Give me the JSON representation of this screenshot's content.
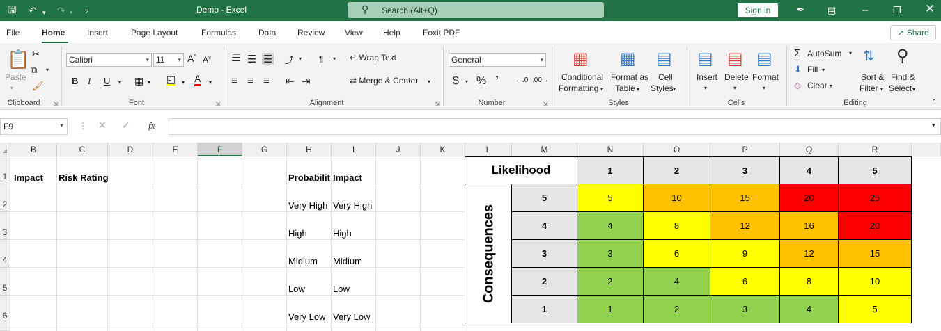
{
  "title": "Demo  -  Excel",
  "search_placeholder": "Search (Alt+Q)",
  "signin": "Sign in",
  "tabs": [
    "File",
    "Home",
    "Insert",
    "Page Layout",
    "Formulas",
    "Data",
    "Review",
    "View",
    "Help",
    "Foxit PDF"
  ],
  "share": "Share",
  "ribbon": {
    "paste": "Paste",
    "font_name": "Calibri",
    "font_size": "11",
    "wrap_text": "Wrap Text",
    "merge_center": "Merge & Center",
    "number_format": "General",
    "cond_fmt": [
      "Conditional",
      "Formatting"
    ],
    "format_table": [
      "Format as",
      "Table"
    ],
    "cell_styles": [
      "Cell",
      "Styles"
    ],
    "insert": "Insert",
    "delete": "Delete",
    "format": "Format",
    "autosum": "AutoSum",
    "fill": "Fill",
    "clear": "Clear",
    "sort_filter": [
      "Sort &",
      "Filter"
    ],
    "find_select": [
      "Find &",
      "Select"
    ],
    "groups": {
      "clipboard": "Clipboard",
      "font": "Font",
      "alignment": "Alignment",
      "number": "Number",
      "styles": "Styles",
      "cells": "Cells",
      "editing": "Editing"
    }
  },
  "name_box": "F9",
  "formula_fx": "fx",
  "columns": [
    "B",
    "C",
    "D",
    "E",
    "F",
    "G",
    "H",
    "I",
    "J",
    "K",
    "L",
    "M",
    "N",
    "O",
    "P",
    "Q",
    "R"
  ],
  "rows": [
    "1",
    "2",
    "3",
    "4",
    "5",
    "6"
  ],
  "cells": {
    "B1": "Impact",
    "C1": "Risk Rating",
    "H1": "Probabilit",
    "I1": "Impact",
    "H2": "Very High",
    "I2": "Very High",
    "H3": "High",
    "I3": "High",
    "H4": "Midium",
    "I4": "Midium",
    "H5": "Low",
    "I5": "Low",
    "H6": "Very Low",
    "I6": "Very Low"
  },
  "matrix": {
    "likelihood_label": "Likelihood",
    "consequences_label": "Consequences",
    "likelihood": [
      "1",
      "2",
      "3",
      "4",
      "5"
    ],
    "consequences": [
      "5",
      "4",
      "3",
      "2",
      "1"
    ],
    "values": [
      [
        "5",
        "10",
        "15",
        "20",
        "25"
      ],
      [
        "4",
        "8",
        "12",
        "16",
        "20"
      ],
      [
        "3",
        "6",
        "9",
        "12",
        "15"
      ],
      [
        "2",
        "4",
        "6",
        "8",
        "10"
      ],
      [
        "1",
        "2",
        "3",
        "4",
        "5"
      ]
    ],
    "colors": {
      "green": "#92d050",
      "yellow": "#ffff00",
      "orange": "#ffc000",
      "red": "#ff0000"
    },
    "color_map": [
      [
        "yellow",
        "orange",
        "orange",
        "red",
        "red"
      ],
      [
        "green",
        "yellow",
        "orange",
        "orange",
        "red"
      ],
      [
        "green",
        "yellow",
        "yellow",
        "orange",
        "orange"
      ],
      [
        "green",
        "green",
        "yellow",
        "yellow",
        "yellow"
      ],
      [
        "green",
        "green",
        "green",
        "green",
        "yellow"
      ]
    ]
  }
}
